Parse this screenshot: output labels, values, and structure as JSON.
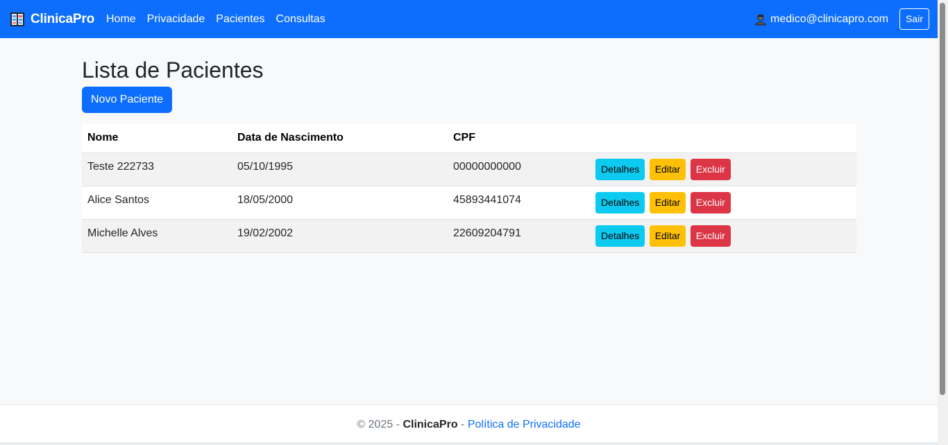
{
  "navbar": {
    "brand": "ClinicaPro",
    "links": [
      "Home",
      "Privacidade",
      "Pacientes",
      "Consultas"
    ],
    "user_email": "medico@clinicapro.com",
    "logout_label": "Sair"
  },
  "main": {
    "title": "Lista de Pacientes",
    "new_button_label": "Novo Paciente",
    "table": {
      "headers": [
        "Nome",
        "Data de Nascimento",
        "CPF",
        ""
      ],
      "rows": [
        {
          "name": "Teste 222733",
          "birth": "05/10/1995",
          "cpf": "00000000000"
        },
        {
          "name": "Alice Santos",
          "birth": "18/05/2000",
          "cpf": "45893441074"
        },
        {
          "name": "Michelle Alves",
          "birth": "19/02/2002",
          "cpf": "22609204791"
        }
      ],
      "actions": {
        "details": "Detalhes",
        "edit": "Editar",
        "delete": "Excluir"
      }
    }
  },
  "footer": {
    "copyright": "© 2025 - ",
    "brand": "ClinicaPro",
    "separator": " - ",
    "privacy_link": "Política de Privacidade"
  },
  "colors": {
    "primary": "#0d6efd",
    "info": "#0dcaf0",
    "warning": "#ffc107",
    "danger": "#dc3545"
  }
}
